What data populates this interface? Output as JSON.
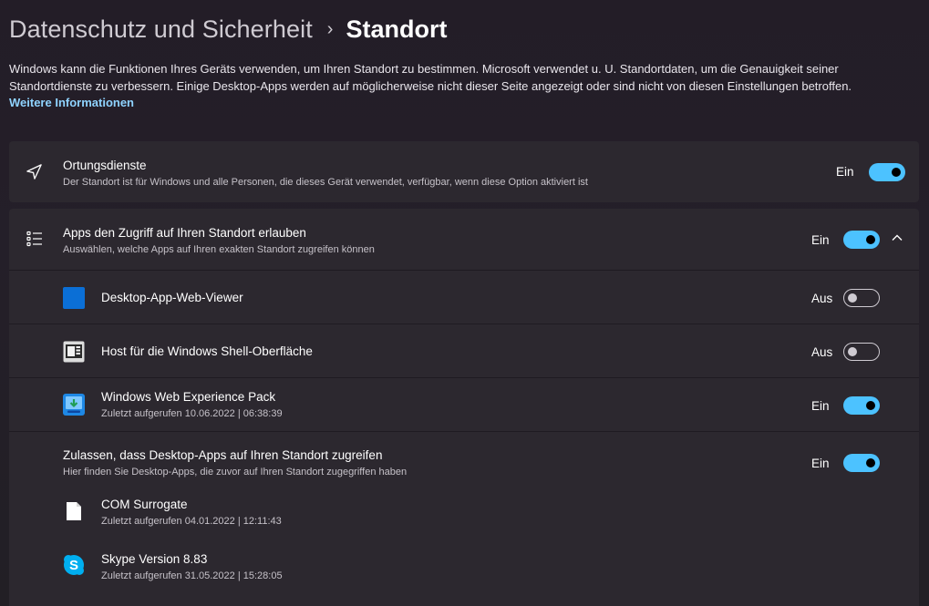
{
  "breadcrumb": {
    "parent": "Datenschutz und Sicherheit",
    "separator": "›",
    "current": "Standort"
  },
  "description": "Windows kann die Funktionen Ihres Geräts verwenden, um Ihren Standort zu bestimmen. Microsoft verwendet u. U. Standortdaten, um die Genauigkeit seiner Standortdienste zu verbessern. Einige Desktop-Apps werden auf möglicherweise nicht dieser Seite angezeigt oder sind nicht von diesen Einstellungen betroffen.",
  "more_link": "Weitere Informationen",
  "location_services": {
    "icon": "location-arrow-icon",
    "title": "Ortungsdienste",
    "subtitle": "Der Standort ist für Windows und alle Personen, die dieses Gerät verwendet, verfügbar, wenn diese Option aktiviert ist",
    "state_label": "Ein",
    "enabled": true
  },
  "app_access": {
    "icon": "list-icon",
    "title": "Apps den Zugriff auf Ihren Standort erlauben",
    "subtitle": "Auswählen, welche Apps auf Ihren exakten Standort zugreifen können",
    "state_label": "Ein",
    "enabled": true,
    "expanded": true,
    "apps": [
      {
        "name": "Desktop-App-Web-Viewer",
        "last_used": "",
        "state_label": "Aus",
        "enabled": false,
        "icon": "web-viewer-icon"
      },
      {
        "name": "Host für die Windows Shell-Oberfläche",
        "last_used": "",
        "state_label": "Aus",
        "enabled": false,
        "icon": "shell-host-icon"
      },
      {
        "name": "Windows Web Experience Pack",
        "last_used": "Zuletzt aufgerufen 10.06.2022  |  06:38:39",
        "state_label": "Ein",
        "enabled": true,
        "icon": "web-experience-pack-icon"
      }
    ]
  },
  "desktop_apps": {
    "title": "Zulassen, dass Desktop-Apps auf Ihren Standort zugreifen",
    "subtitle": "Hier finden Sie Desktop-Apps, die zuvor auf Ihren Standort zugegriffen haben",
    "state_label": "Ein",
    "enabled": true,
    "apps": [
      {
        "name": "COM Surrogate",
        "last_used": "Zuletzt aufgerufen 04.01.2022  |  12:11:43",
        "icon": "file-icon"
      },
      {
        "name": "Skype Version 8.83",
        "last_used": "Zuletzt aufgerufen 31.05.2022  |  15:28:05",
        "icon": "skype-icon"
      }
    ]
  },
  "colors": {
    "accent": "#4cc2ff",
    "link": "#8fd3ff",
    "card": "#2c282f",
    "background": "#231d27"
  }
}
